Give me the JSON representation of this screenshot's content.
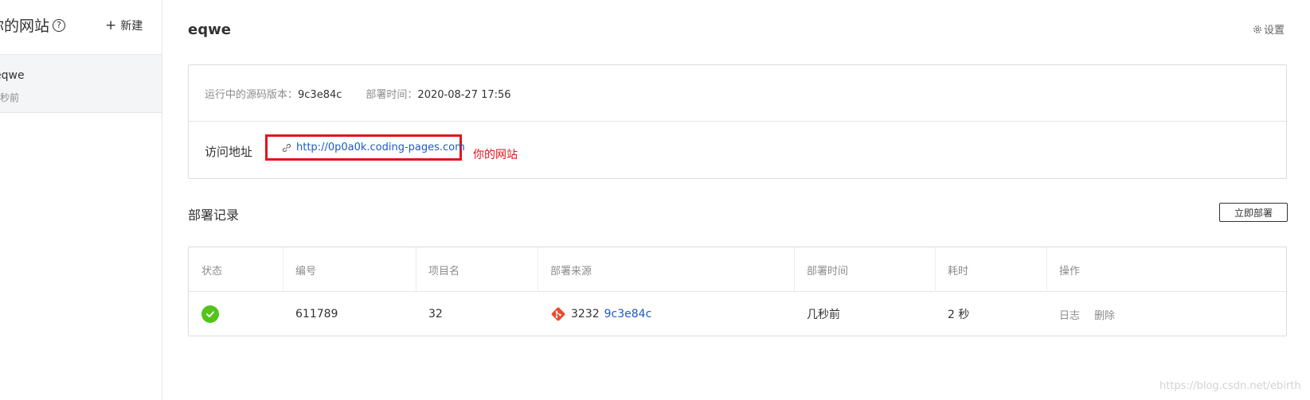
{
  "sidebar": {
    "title": "你的网站",
    "help_icon": "question-circle-icon",
    "new_label": "新建",
    "items": [
      {
        "name": "eqwe",
        "time": "几秒前"
      }
    ]
  },
  "header": {
    "title": "eqwe",
    "settings_label": "设置",
    "settings_icon": "gear-icon"
  },
  "info": {
    "version_label": "运行中的源码版本：",
    "version_value": "9c3e84c",
    "deploy_time_label": "部署时间：",
    "deploy_time_value": "2020-08-27 17:56",
    "visit_label": "访问地址",
    "url": "http://0p0a0k.coding-pages.com",
    "annotation": "你的网站",
    "annotation_color": "#e3131b"
  },
  "deploy": {
    "section_title": "部署记录",
    "deploy_button": "立即部署",
    "columns": [
      "状态",
      "编号",
      "项目名",
      "部署来源",
      "部署时间",
      "耗时",
      "操作"
    ],
    "rows": [
      {
        "status": "success",
        "id": "611789",
        "project": "32",
        "source_branch": "3232",
        "source_commit": "9c3e84c",
        "time": "几秒前",
        "duration": "2 秒",
        "actions": [
          "日志",
          "删除"
        ]
      }
    ]
  },
  "colors": {
    "link": "#1f58c7",
    "success": "#52c41a",
    "git": "#e84d31",
    "highlight": "#e3131b"
  },
  "watermark": "https://blog.csdn.net/ebirth"
}
